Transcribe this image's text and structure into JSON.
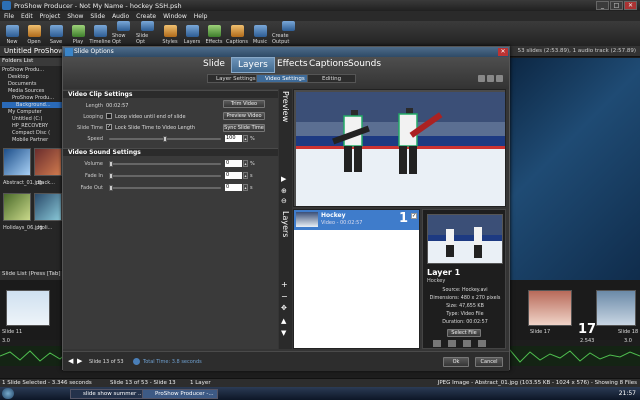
{
  "window": {
    "title": "ProShow Producer - Not My Name - hockey SSH.psh",
    "min": "_",
    "max": "□",
    "close": "✕"
  },
  "menu": [
    "File",
    "Edit",
    "Project",
    "Show",
    "Slide",
    "Audio",
    "Create",
    "Window",
    "Help"
  ],
  "toolbar": [
    "New",
    "Open",
    "Save",
    "Play",
    "Timeline",
    "Show Opt",
    "Slide Opt",
    "Styles",
    "Layers",
    "Effects",
    "Captions",
    "Music",
    "Create Output"
  ],
  "show": {
    "title": "Untitled ProShow 1",
    "info": "53 slides (2:53.89), 1 audio track (2:57.89)"
  },
  "folders": {
    "header": "Folders List",
    "items": [
      "ProShow Produ...",
      "Desktop",
      "Documents",
      "Media Sources",
      "ProShow Produ...",
      "Background...",
      "My Computer",
      "Untitled (C:)",
      "HP_RECOVERY",
      "Compact Disc (",
      "Mobile Partner"
    ],
    "selected_index": 5,
    "thumbs": [
      "Abstract_01.jpg",
      "Back...",
      "Holidays_06.jpg",
      "Holi..."
    ]
  },
  "dialog": {
    "title": "Slide Options",
    "tabs": [
      "Slide",
      "Layers",
      "Effects",
      "Captions",
      "Sounds"
    ],
    "active_tab": 1,
    "subtabs": [
      "Layer Settings",
      "Video Settings",
      "Editing"
    ],
    "active_subtab": 1,
    "video": {
      "section": "Video Clip Settings",
      "length_label": "Length",
      "length_value": "00:02:57",
      "trim_button": "Trim Video",
      "looping_label": "Looping",
      "looping_text": "Loop video until end of slide",
      "preview_button": "Preview Video",
      "slide_time_label": "Slide Time",
      "slide_time_text": "Lock Slide Time to Video Length",
      "sync_button": "Sync Slide Time",
      "speed_label": "Speed",
      "speed_value": "100",
      "speed_unit": "%"
    },
    "sound": {
      "section": "Video Sound Settings",
      "rows": [
        {
          "label": "Volume",
          "value": "0",
          "unit": "%"
        },
        {
          "label": "Fade In",
          "value": "0",
          "unit": "s"
        },
        {
          "label": "Fade Out",
          "value": "0",
          "unit": "s"
        }
      ]
    },
    "side_tabs": [
      "Preview",
      "Layers"
    ],
    "layer": {
      "name": "Hockey",
      "sub": "Video - 00:02:57",
      "number": "1"
    },
    "layer_info": {
      "title": "Layer 1",
      "subtitle": "Hockey",
      "source": "Source: Hockey.avi",
      "dimensions": "Dimensions: 480 x 270 pixels",
      "size": "Size: 47,655 KB",
      "type": "Type: Video File",
      "duration": "Duration: 00:02:57",
      "select_button": "Select File"
    },
    "footer": {
      "slide": "Slide 13 of 53",
      "total": "Total Time: 3.8 seconds",
      "ok": "Ok",
      "cancel": "Cancel"
    }
  },
  "slide_list": {
    "header": "Slide List (Press [Tab] for",
    "slides": [
      {
        "label": "Slide 11",
        "time": "3.0"
      },
      {
        "label": "Slide 17",
        "time": "2.543",
        "number": "17"
      },
      {
        "label": "Slide 18",
        "time": "3.0"
      }
    ]
  },
  "status": {
    "left": "1 Slide Selected - 3.346 seconds",
    "middle": "Slide 13 of 53 - Slide 13",
    "layers": "1 Layer",
    "right": "JPEG Image - Abstract_01.jpg (103.55 KB - 1024 x 576) - Showing 8 Files"
  },
  "taskbar": {
    "items": [
      "slide show summer ...",
      "ProShow Producer -..."
    ],
    "clock": "21:57"
  }
}
